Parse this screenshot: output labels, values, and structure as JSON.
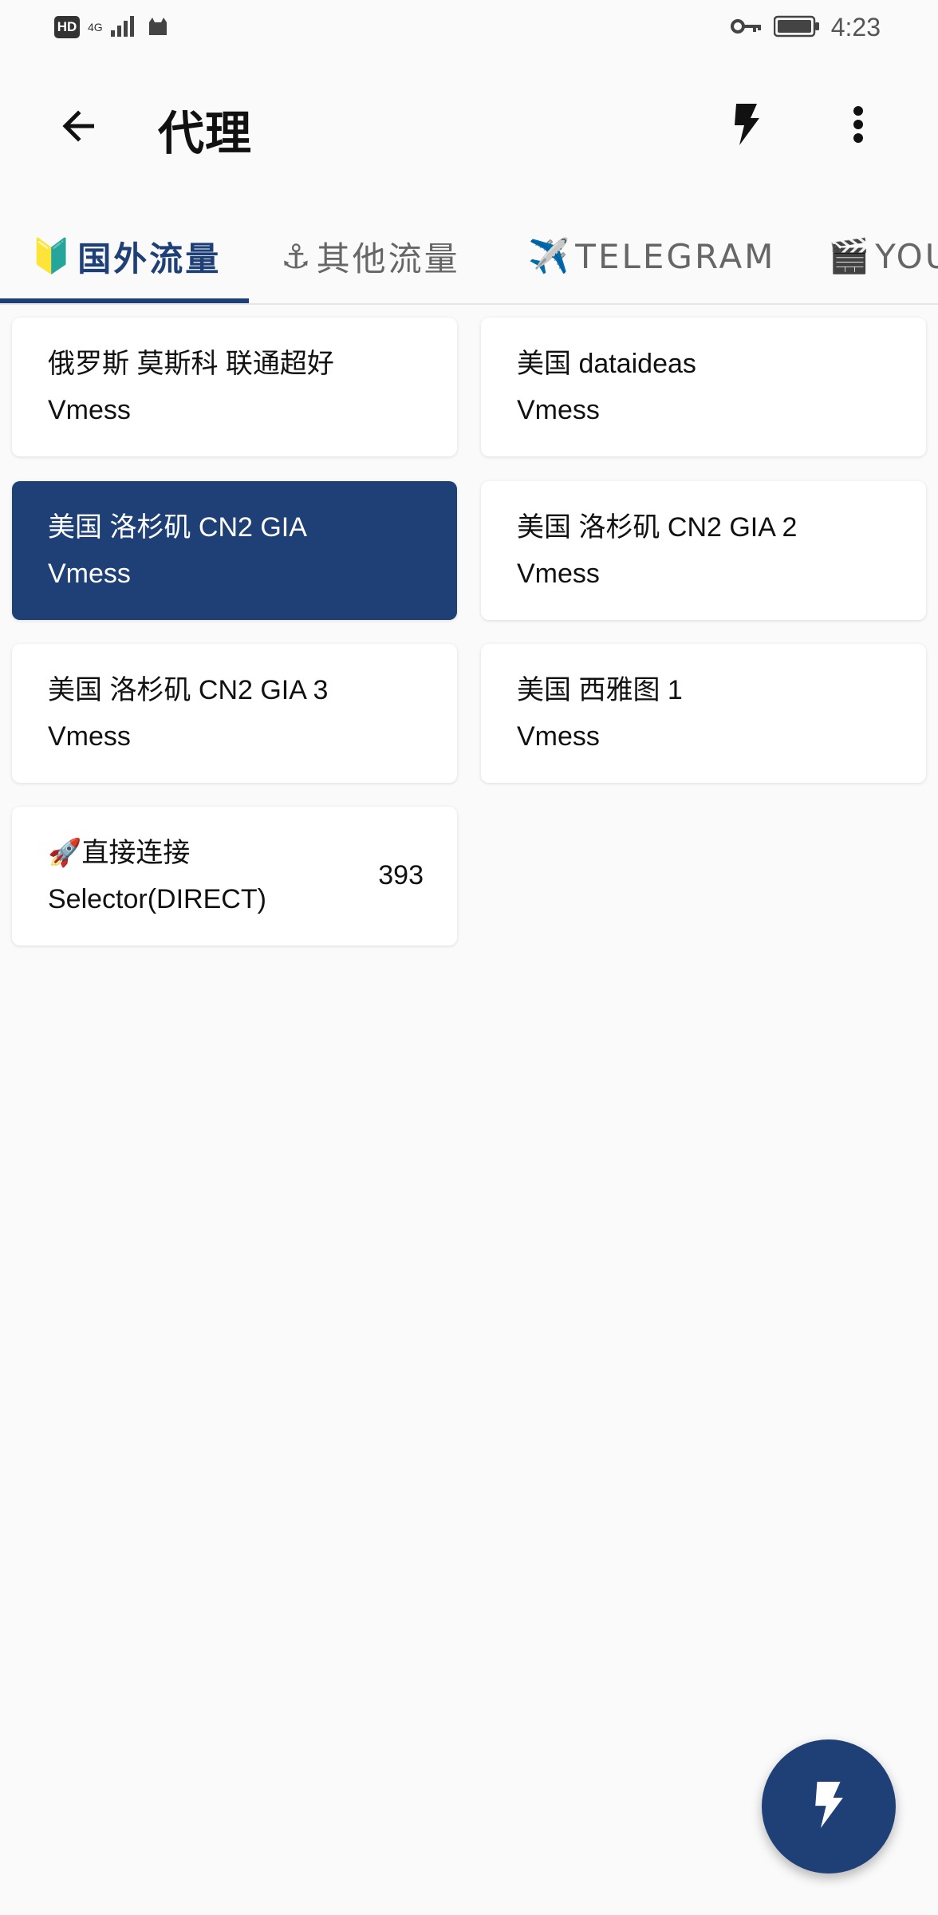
{
  "status_bar": {
    "hd": "HD",
    "network": "4G",
    "time": "4:23"
  },
  "app_bar": {
    "title": "代理"
  },
  "tabs": [
    {
      "emoji": "🔰",
      "label": "国外流量",
      "active": true
    },
    {
      "emoji": "⚓",
      "label": "其他流量",
      "active": false
    },
    {
      "emoji": "✈️",
      "label": "TELEGRAM",
      "active": false
    },
    {
      "emoji": "🎬",
      "label": "YOU",
      "active": false
    }
  ],
  "proxies": [
    {
      "name": "俄罗斯 莫斯科 联通超好",
      "type": "Vmess",
      "delay": ""
    },
    {
      "name": "美国 dataideas",
      "type": "Vmess",
      "delay": ""
    },
    {
      "name": "美国 洛杉矶 CN2 GIA",
      "type": "Vmess",
      "delay": "",
      "selected": true
    },
    {
      "name": "美国 洛杉矶 CN2 GIA 2",
      "type": "Vmess",
      "delay": ""
    },
    {
      "name": "美国 洛杉矶 CN2 GIA 3",
      "type": "Vmess",
      "delay": ""
    },
    {
      "name": "美国 西雅图 1",
      "type": "Vmess",
      "delay": ""
    },
    {
      "name": "🚀直接连接",
      "type": "Selector(DIRECT)",
      "delay": "393"
    }
  ],
  "colors": {
    "accent": "#1e4077",
    "background": "#fafafa",
    "card": "#ffffff"
  },
  "icons": {
    "back": "arrow-left-icon",
    "test": "lightning-bolt-icon",
    "more": "more-vertical-icon",
    "fab": "lightning-bolt-icon"
  }
}
